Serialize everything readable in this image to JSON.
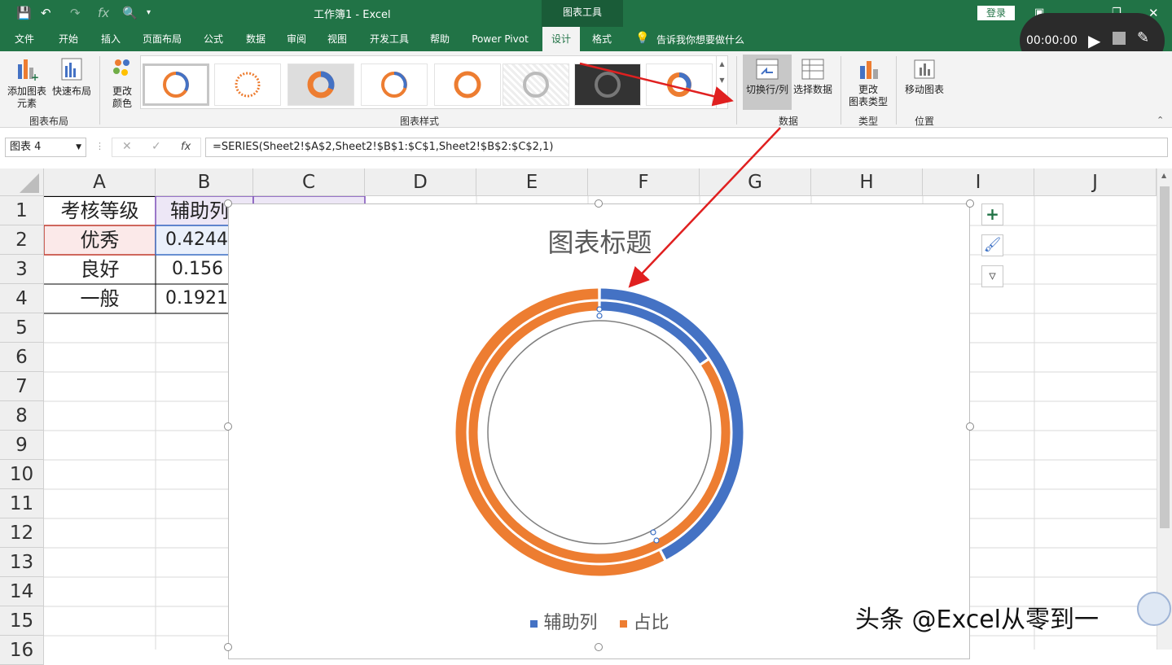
{
  "app": {
    "title": "工作簿1 - Excel",
    "context_tab": "图表工具",
    "login": "登录",
    "timer": "00:00:00"
  },
  "tabs": [
    "文件",
    "开始",
    "插入",
    "页面布局",
    "公式",
    "数据",
    "审阅",
    "视图",
    "开发工具",
    "帮助",
    "Power Pivot",
    "设计",
    "格式"
  ],
  "tell_me": "告诉我你想要做什么",
  "ribbon": {
    "add_element": "添加图表\n元素",
    "quick_layout": "快速布局",
    "change_color": "更改\n颜色",
    "switch_row_col": "切换行/列",
    "select_data": "选择数据",
    "change_type": "更改\n图表类型",
    "move_chart": "移动图表",
    "groups": {
      "layout": "图表布局",
      "styles": "图表样式",
      "data": "数据",
      "type": "类型",
      "location": "位置"
    }
  },
  "formula_bar": {
    "name_box": "图表 4",
    "fx": "fx",
    "formula": "=SERIES(Sheet2!$A$2,Sheet2!$B$1:$C$1,Sheet2!$B$2:$C$2,1)"
  },
  "columns": [
    "A",
    "B",
    "C",
    "D",
    "E",
    "F",
    "G",
    "H",
    "I",
    "J"
  ],
  "rows": [
    "1",
    "2",
    "3",
    "4",
    "5",
    "6",
    "7",
    "8",
    "9",
    "10",
    "11",
    "12",
    "13",
    "14",
    "15",
    "16"
  ],
  "cells": {
    "A1": "考核等级",
    "B1": "辅助列",
    "A2": "优秀",
    "B2": "0.4244",
    "A3": "良好",
    "B3": "0.156",
    "A4": "一般",
    "B4": "0.1921"
  },
  "chart": {
    "title": "图表标题",
    "legend": [
      "辅助列",
      "占比"
    ]
  },
  "colors": {
    "blue": "#4472c4",
    "orange": "#ed7d31",
    "excel_green": "#217346",
    "arrow": "#e02020"
  },
  "watermark": "头条 @Excel从零到一",
  "chart_data": {
    "type": "pie",
    "title": "图表标题",
    "series": [
      {
        "name": "辅助列",
        "values": [
          0.4244,
          0.5756
        ]
      },
      {
        "name": "占比",
        "values": [
          0.156,
          0.844
        ]
      }
    ],
    "legend_position": "bottom"
  }
}
